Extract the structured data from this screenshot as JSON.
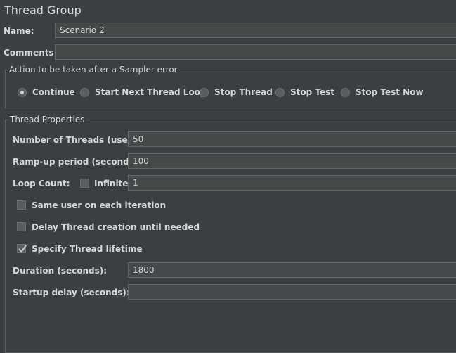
{
  "title": "Thread Group",
  "name": {
    "label": "Name:",
    "value": "Scenario 2"
  },
  "comments": {
    "label": "Comments:",
    "value": ""
  },
  "sampler_error": {
    "legend": "Action to be taken after a Sampler error",
    "options": [
      {
        "label": "Continue",
        "selected": true
      },
      {
        "label": "Start Next Thread Loop",
        "selected": false
      },
      {
        "label": "Stop Thread",
        "selected": false
      },
      {
        "label": "Stop Test",
        "selected": false
      },
      {
        "label": "Stop Test Now",
        "selected": false
      }
    ]
  },
  "thread_properties": {
    "legend": "Thread Properties",
    "num_threads": {
      "label": "Number of Threads (users):",
      "value": "50"
    },
    "ramp_up": {
      "label": "Ramp-up period (seconds):",
      "value": "100"
    },
    "loop_count": {
      "label": "Loop Count:",
      "infinite_label": "Infinite",
      "infinite_checked": false,
      "value": "1"
    },
    "same_user": {
      "label": "Same user on each iteration",
      "checked": false
    },
    "delay_thread": {
      "label": "Delay Thread creation until needed",
      "checked": false
    },
    "specify_lifetime": {
      "label": "Specify Thread lifetime",
      "checked": true
    },
    "duration": {
      "label": "Duration (seconds):",
      "value": "1800"
    },
    "startup_delay": {
      "label": "Startup delay (seconds):",
      "value": ""
    }
  }
}
